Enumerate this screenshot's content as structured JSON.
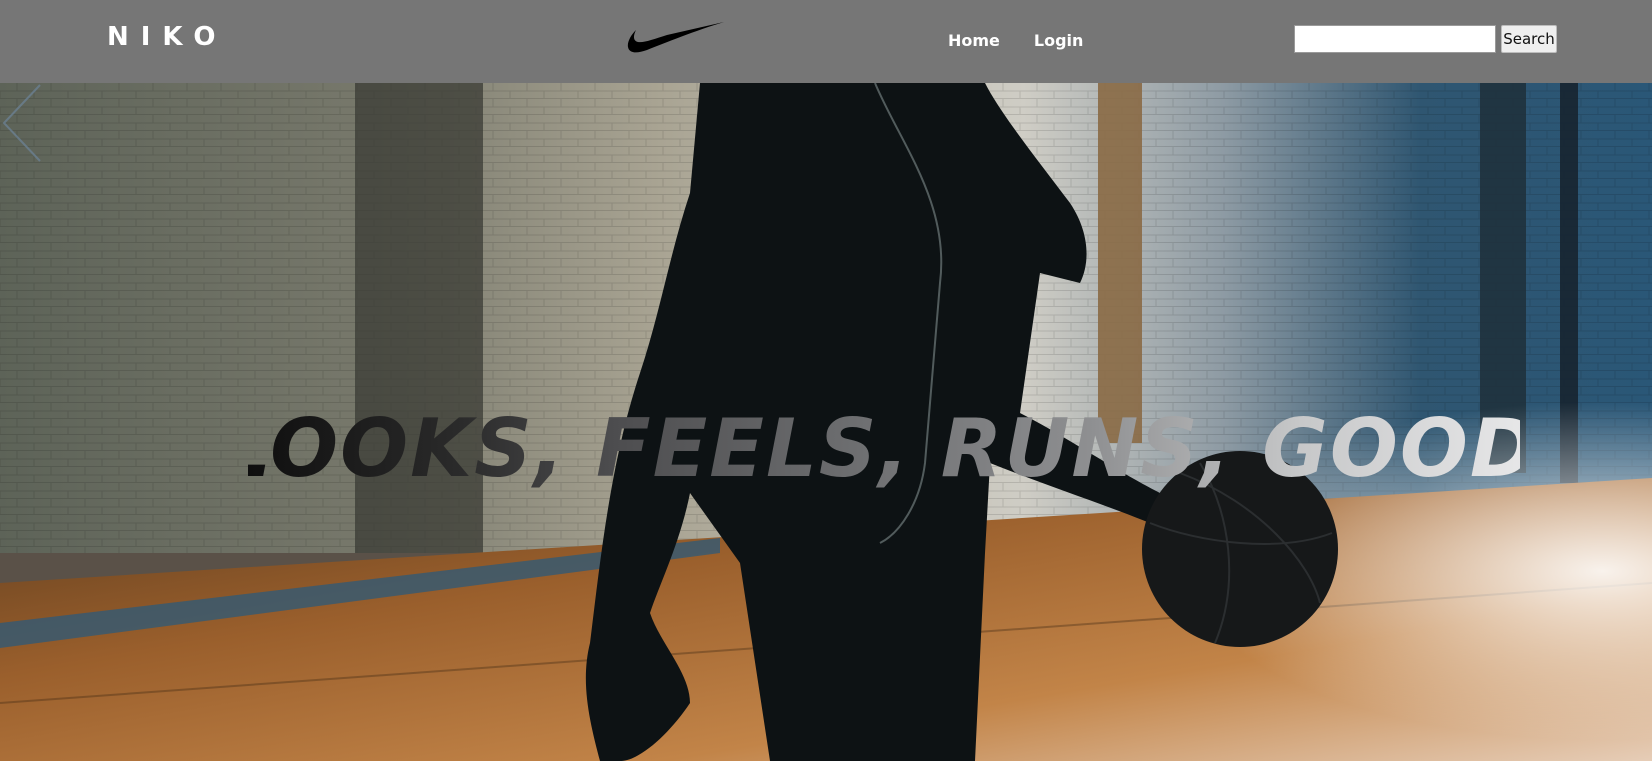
{
  "header": {
    "brand": "NIKO",
    "logo_icon": "nike-swoosh-icon",
    "nav": [
      {
        "label": "Home"
      },
      {
        "label": "Login"
      }
    ],
    "search": {
      "value": "",
      "placeholder": "",
      "button_label": "Search"
    }
  },
  "hero": {
    "background_icon": "basketball-player-court-photo",
    "tagline": "LOOKS, FEELS, RUNS, GOOD",
    "next_icon": "chevron-right-icon"
  },
  "colors": {
    "header_bg": "#767676",
    "header_text": "#ffffff"
  }
}
